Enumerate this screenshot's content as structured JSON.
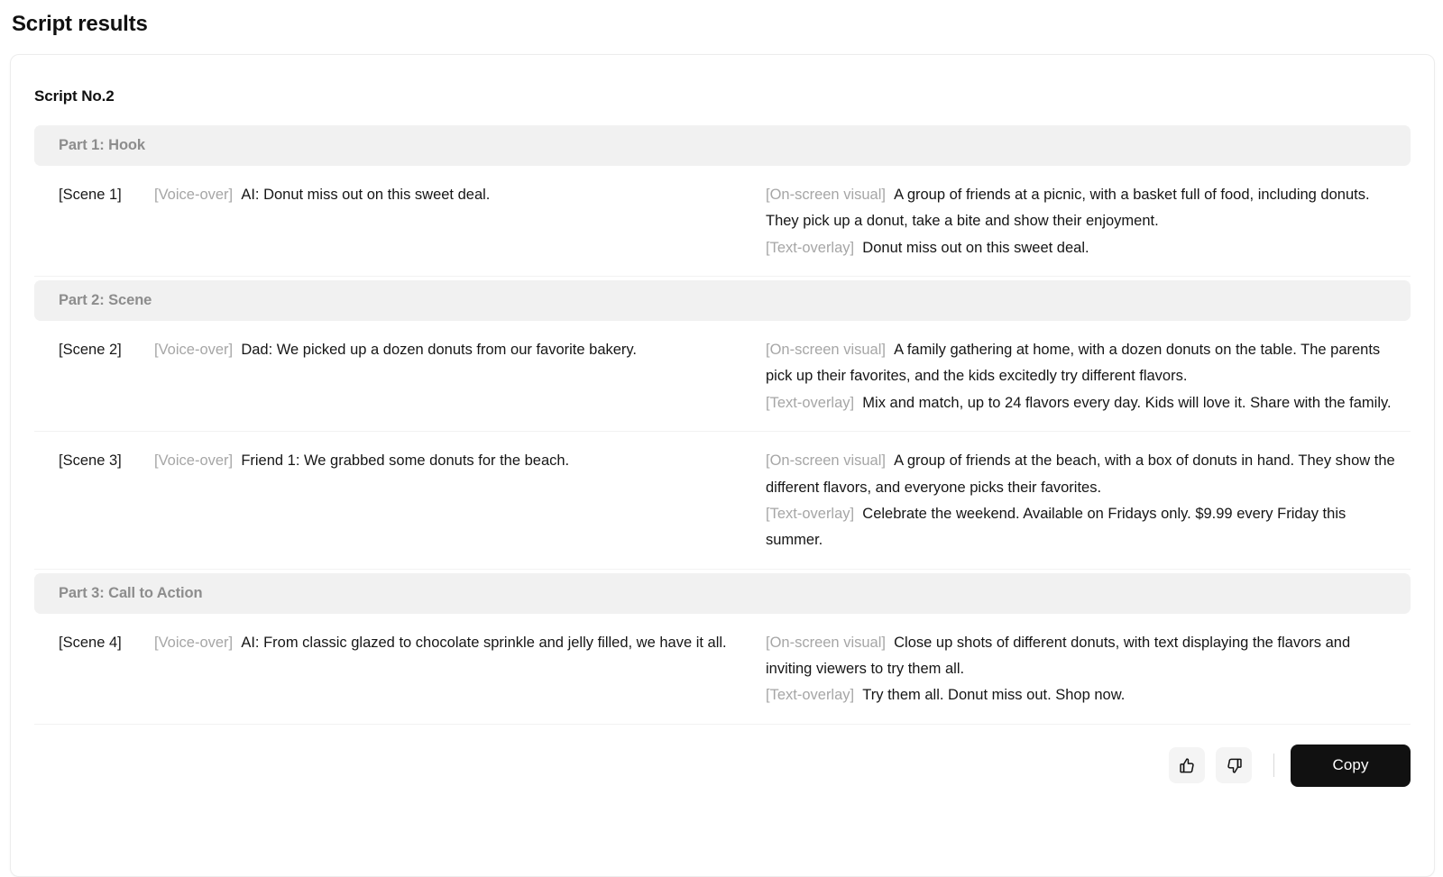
{
  "header": {
    "title": "Script results"
  },
  "card": {
    "title": "Script No.2"
  },
  "labels": {
    "voice_over": "[Voice-over]",
    "on_screen_visual": "[On-screen visual]",
    "text_overlay": "[Text-overlay]"
  },
  "parts": [
    {
      "band_label": "Part 1: Hook",
      "scenes": [
        {
          "scene_id": "[Scene 1]",
          "voice_over": "AI: Donut miss out on this sweet deal.",
          "on_screen_visual": "A group of friends at a picnic, with a basket full of food, including donuts. They pick up a donut, take a bite and show their enjoyment.",
          "text_overlay": "Donut miss out on this sweet deal."
        }
      ]
    },
    {
      "band_label": "Part 2: Scene",
      "scenes": [
        {
          "scene_id": "[Scene 2]",
          "voice_over": "Dad: We picked up a dozen donuts from our favorite bakery.",
          "on_screen_visual": "A family gathering at home, with a dozen donuts on the table. The parents pick up their favorites, and the kids excitedly try different flavors.",
          "text_overlay": "Mix and match, up to 24 flavors every day. Kids will love it. Share with the family."
        },
        {
          "scene_id": "[Scene 3]",
          "voice_over": "Friend 1: We grabbed some donuts for the beach.",
          "on_screen_visual": "A group of friends at the beach, with a box of donuts in hand. They show the different flavors, and everyone picks their favorites.",
          "text_overlay": "Celebrate the weekend. Available on Fridays only. $9.99 every Friday this summer."
        }
      ]
    },
    {
      "band_label": "Part 3: Call to Action",
      "scenes": [
        {
          "scene_id": "[Scene 4]",
          "voice_over": "AI: From classic glazed to chocolate sprinkle and jelly filled, we have it all.",
          "on_screen_visual": "Close up shots of different donuts, with text displaying the flavors and inviting viewers to try them all.",
          "text_overlay": "Try them all. Donut miss out. Shop now."
        }
      ]
    }
  ],
  "footer": {
    "thumbs_up_icon": "thumbs-up-icon",
    "thumbs_down_icon": "thumbs-down-icon",
    "copy_label": "Copy"
  },
  "colors": {
    "accent": "#111111",
    "band_bg": "#f1f1f1",
    "tag_text": "#a6a6a6",
    "body_text": "#161616"
  }
}
